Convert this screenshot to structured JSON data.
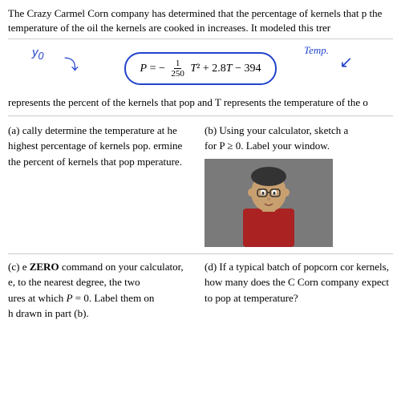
{
  "intro": {
    "text": "The Crazy Carmel Corn company has determined that the percentage of kernels that p the temperature of the oil the kernels are cooked in increases.  It modeled this trer"
  },
  "formula": {
    "display": "P = -\\frac{1}{250}T^2 + 2.8T - 394",
    "annotation_y0": "y₀",
    "annotation_temp": "Temp.",
    "p_label": "P =",
    "fraction_num": "1",
    "fraction_den": "250",
    "rest": "T² + 2.8T − 394"
  },
  "represents": {
    "text": "represents the percent of the kernels that pop and T represents the temperature of the o"
  },
  "part_a": {
    "label": "(a)",
    "text": "cally determine the temperature at he highest percentage of kernels pop. ermine the percent of kernels that pop mperature."
  },
  "part_b": {
    "label": "(b) Using your calculator, sketch a",
    "text2": "for P ≥ 0.  Label your window."
  },
  "part_c": {
    "label": "(c)",
    "text": "e ZERO command on your calculator, e, to the nearest degree, the two ures at which P = 0.  Label them on h drawn in part (b).",
    "zero_bold": "ZERO"
  },
  "part_d": {
    "label": "(d)",
    "text": "If a typical batch of popcorn cor kernels, how many does the C Corn company expect to pop at temperature?"
  }
}
